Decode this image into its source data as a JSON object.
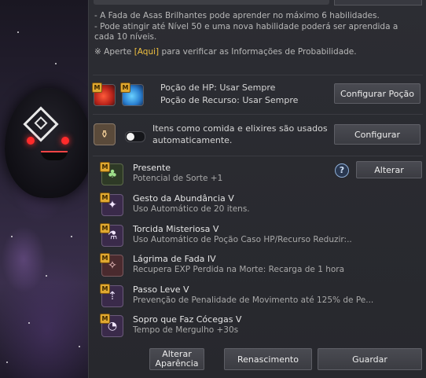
{
  "info": {
    "line1": "- A Fada de Asas Brilhantes pode aprender no máximo 6 habilidades.",
    "line2": "- Pode atingir até Nível 50 e uma nova habilidade poderá ser aprendida a",
    "line3": "cada 10 níveis.",
    "note_prefix": "※ Aperte ",
    "note_link": "[Aqui]",
    "note_suffix": " para verificar as Informações de Probabilidade."
  },
  "potion": {
    "hp_label": "Poção de HP: Usar Sempre",
    "resource_label": "Poção de Recurso: Usar Sempre",
    "button": "Configurar Poção"
  },
  "auto_items": {
    "text1": "Itens como comida e elixires são usados",
    "text2": "automaticamente.",
    "button": "Configurar"
  },
  "abilities": [
    {
      "badge": "M",
      "name": "Presente",
      "desc": "Potencial de Sorte +1",
      "icon": "clover-icon",
      "glyph": "♣"
    },
    {
      "badge": "M",
      "name": "Gesto da Abundância V",
      "desc": "Uso Automático de 20 itens.",
      "icon": "fairy-icon",
      "glyph": "✦"
    },
    {
      "badge": "M",
      "name": "Torcida Misteriosa V",
      "desc": "Uso Automático de Poção Caso HP/Recurso Reduzir:..",
      "icon": "potion-cheer-icon",
      "glyph": "⚗"
    },
    {
      "badge": "M",
      "name": "Lágrima de Fada IV",
      "desc": "Recupera EXP Perdida na Morte: Recarga de 1 hora",
      "icon": "teardrop-icon",
      "glyph": "✧"
    },
    {
      "badge": "M",
      "name": "Passo Leve V",
      "desc": "Prevenção de Penalidade de Movimento até 125% de Pe...",
      "icon": "boot-icon",
      "glyph": "⇡"
    },
    {
      "badge": "M",
      "name": "Sopro que Faz Cócegas V",
      "desc": "Tempo de Mergulho +30s",
      "icon": "breath-icon",
      "glyph": "◔"
    }
  ],
  "help_icon": "?",
  "alter_button": "Alterar",
  "footer": {
    "appearance_line1": "Alterar",
    "appearance_line2": "Aparência",
    "rebirth": "Renascimento",
    "save": "Guardar"
  }
}
